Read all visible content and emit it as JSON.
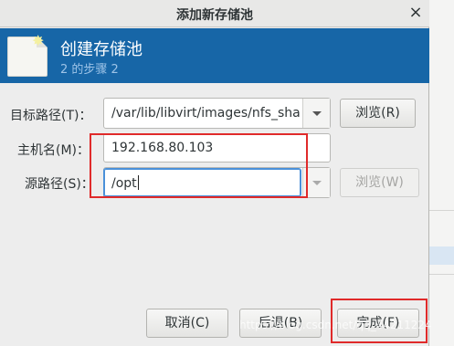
{
  "window": {
    "title": "添加新存储池",
    "close_glyph": "×"
  },
  "header": {
    "title": "创建存储池",
    "step": "2 的步骤 2",
    "icon": "storage-pool-icon"
  },
  "form": {
    "target_path_label": "目标路径(T)：",
    "target_path_value": "/var/lib/libvirt/images/nfs_share",
    "target_browse_label": "浏览(R)",
    "hostname_label": "主机名(M)：",
    "hostname_value": "192.168.80.103",
    "source_path_label": "源路径(S)：",
    "source_path_value": "/opt",
    "source_browse_label": "浏览(W)"
  },
  "buttons": {
    "cancel": "取消(C)",
    "back": "后退(B)",
    "finish": "完成(F)"
  },
  "watermark": "https://blog.csdn.net/qq_44211224",
  "colors": {
    "header_bg": "#1766a7",
    "highlight_box": "#e02a2a",
    "focus": "#4a90d9"
  }
}
